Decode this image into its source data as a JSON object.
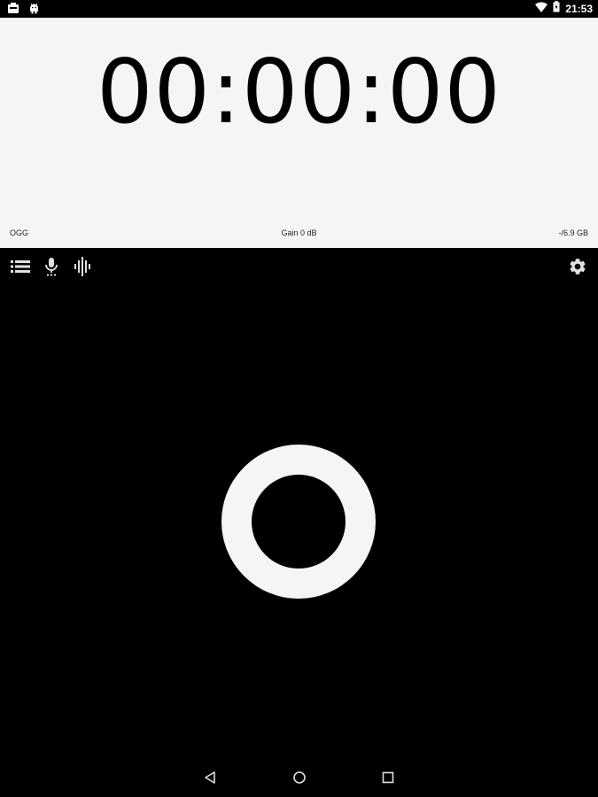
{
  "status_bar": {
    "time": "21:53",
    "left_icons": [
      "notification-icon",
      "android-icon"
    ],
    "right_icons": [
      "wifi-icon",
      "battery-icon"
    ]
  },
  "timer": {
    "display": "00:00:00"
  },
  "info": {
    "format": "OGG",
    "gain": "Gain 0 dB",
    "storage": "-/6.9 GB"
  },
  "toolbar": {
    "left_icons": [
      "list-icon",
      "microphone-icon",
      "waveform-icon"
    ],
    "right_icons": [
      "settings-icon"
    ]
  },
  "record": {
    "icon": "record-icon"
  },
  "nav_bar": {
    "icons": [
      "back-icon",
      "home-icon",
      "recents-icon"
    ]
  },
  "colors": {
    "panel_background": "#f5f5f5",
    "app_background": "#000000",
    "timer_text": "#000000",
    "icon_color": "#e0e0e0"
  }
}
